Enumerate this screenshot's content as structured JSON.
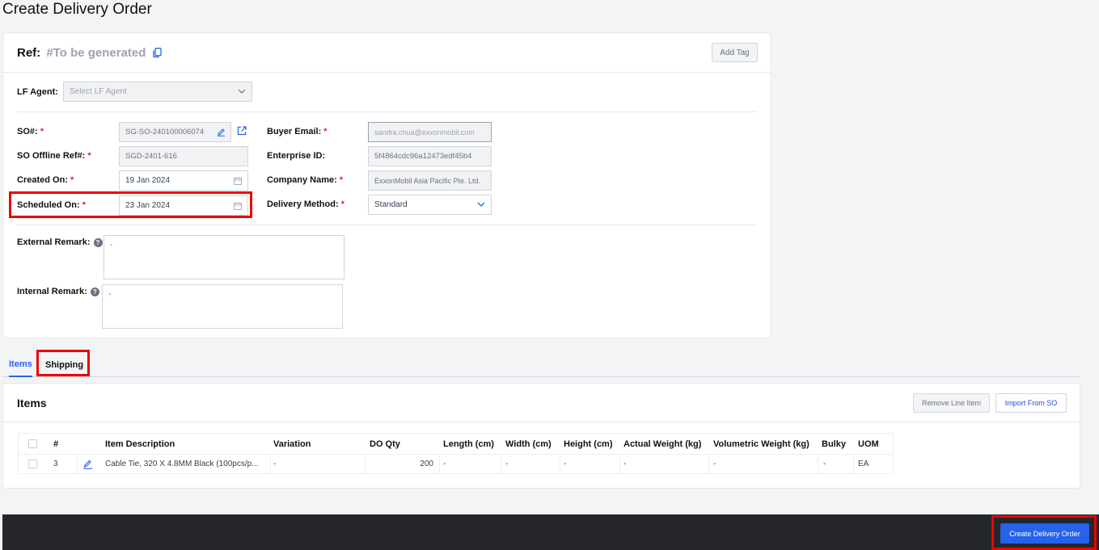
{
  "page": {
    "title": "Create Delivery Order"
  },
  "ref": {
    "label": "Ref:",
    "value": "#To be generated",
    "add_tag_label": "Add Tag"
  },
  "lf_agent": {
    "label": "LF Agent:",
    "placeholder": "Select LF Agent"
  },
  "left_fields": [
    {
      "label": "SO#:",
      "value": "SG-SO-240100006074"
    },
    {
      "label": "SO Offline Ref#:",
      "value": "SGD-2401-616"
    },
    {
      "label": "Created On:",
      "value": "19 Jan 2024"
    },
    {
      "label": "Scheduled On:",
      "value": "23 Jan 2024"
    }
  ],
  "right_fields": [
    {
      "label": "Buyer Email:",
      "value": "sandra.chua@exxonmobil.com"
    },
    {
      "label": "Enterprise ID:",
      "value": "5f4864cdc96a12473edf45b4"
    },
    {
      "label": "Company Name:",
      "value": "ExxonMobil Asia Pacific Pte. Ltd."
    },
    {
      "label": "Delivery Method:",
      "value": "Standard"
    }
  ],
  "remarks": {
    "external_label": "External Remark:",
    "external_value": "-",
    "internal_label": "Internal Remark:",
    "internal_value": "-"
  },
  "tabs": [
    {
      "label": "Items"
    },
    {
      "label": "Shipping"
    }
  ],
  "items": {
    "title": "Items",
    "remove_label": "Remove Line Item",
    "import_label": "Import From SO",
    "columns": [
      "#",
      "Item Description",
      "Variation",
      "DO Qty",
      "Length (cm)",
      "Width (cm)",
      "Height (cm)",
      "Actual Weight (kg)",
      "Volumetric Weight (kg)",
      "Bulky",
      "UOM"
    ],
    "rows": [
      {
        "no": "3",
        "description": "Cable Tie, 320 X 4.8MM Black (100pcs/p...",
        "variation": "-",
        "qty": "200",
        "length": "-",
        "width": "-",
        "height": "-",
        "actual_weight": "-",
        "volumetric_weight": "-",
        "bulky": "-",
        "uom": "EA"
      }
    ]
  },
  "footer": {
    "create_label": "Create Delivery Order"
  },
  "colors": {
    "accent": "#2563eb",
    "highlight": "#ef0000",
    "footer": "#25262b",
    "required": "#dc2626"
  }
}
